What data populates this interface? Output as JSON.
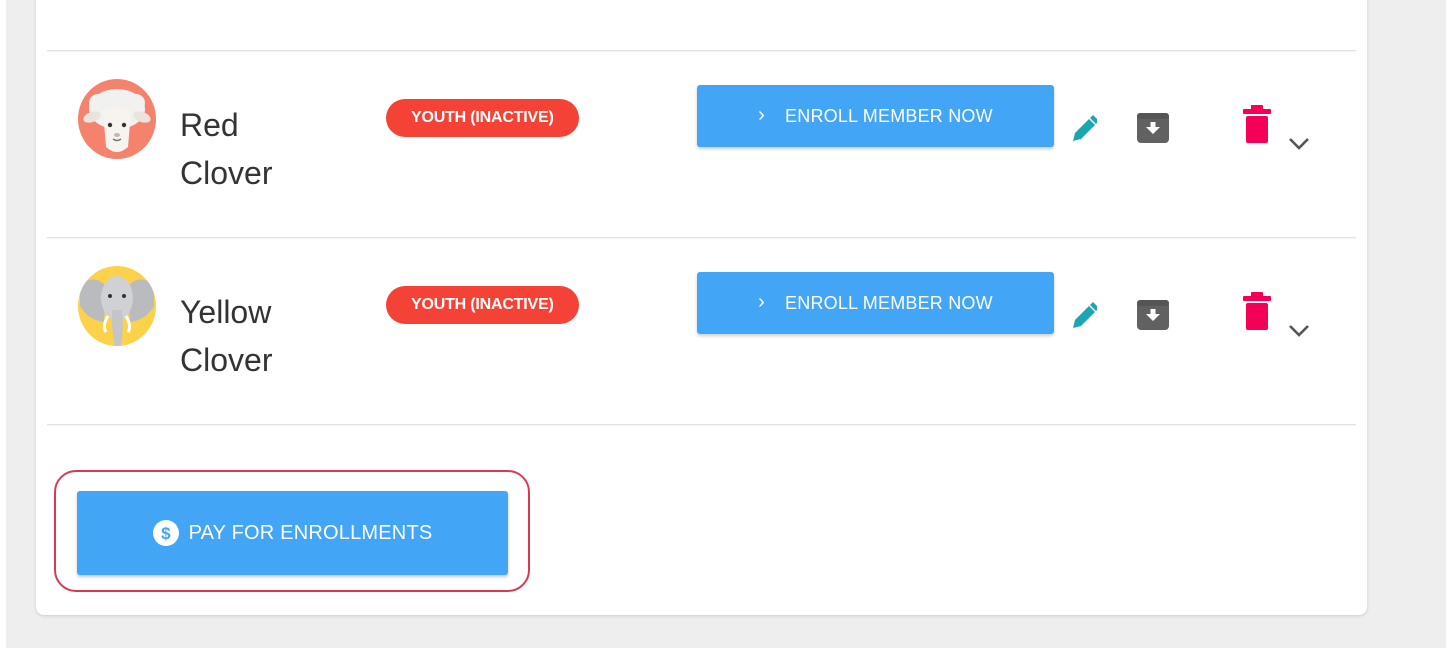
{
  "members": [
    {
      "first_name": "Red",
      "last_name": "Clover",
      "status": "YOUTH (INACTIVE)",
      "avatar_icon": "sheep-avatar-icon",
      "enroll_label": "ENROLL MEMBER NOW"
    },
    {
      "first_name": "Yellow",
      "last_name": "Clover",
      "status": "YOUTH (INACTIVE)",
      "avatar_icon": "elephant-avatar-icon",
      "enroll_label": "ENROLL MEMBER NOW"
    }
  ],
  "pay_button": {
    "label": "PAY FOR ENROLLMENTS",
    "icon": "dollar-circle-icon"
  },
  "colors": {
    "primary_button": "#42a5f5",
    "status_badge": "#f44336",
    "edit_icon": "#1aa6b2",
    "archive_icon": "#616161",
    "delete_icon": "#f50057",
    "highlight": "#d63b52"
  }
}
